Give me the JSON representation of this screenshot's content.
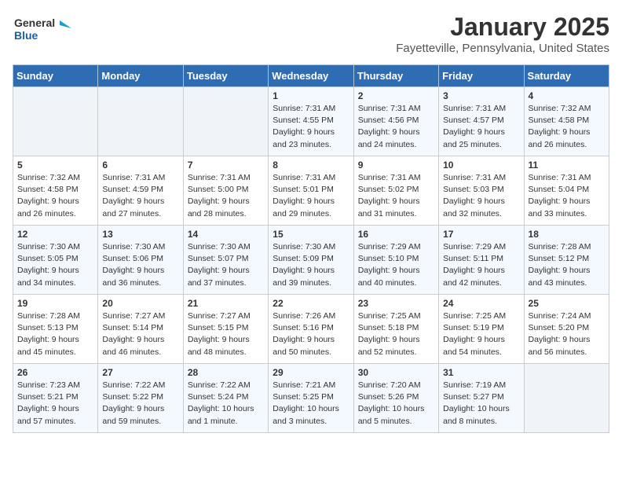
{
  "header": {
    "logo_line1": "General",
    "logo_line2": "Blue",
    "month": "January 2025",
    "location": "Fayetteville, Pennsylvania, United States"
  },
  "weekdays": [
    "Sunday",
    "Monday",
    "Tuesday",
    "Wednesday",
    "Thursday",
    "Friday",
    "Saturday"
  ],
  "weeks": [
    [
      {
        "day": "",
        "info": ""
      },
      {
        "day": "",
        "info": ""
      },
      {
        "day": "",
        "info": ""
      },
      {
        "day": "1",
        "info": "Sunrise: 7:31 AM\nSunset: 4:55 PM\nDaylight: 9 hours\nand 23 minutes."
      },
      {
        "day": "2",
        "info": "Sunrise: 7:31 AM\nSunset: 4:56 PM\nDaylight: 9 hours\nand 24 minutes."
      },
      {
        "day": "3",
        "info": "Sunrise: 7:31 AM\nSunset: 4:57 PM\nDaylight: 9 hours\nand 25 minutes."
      },
      {
        "day": "4",
        "info": "Sunrise: 7:32 AM\nSunset: 4:58 PM\nDaylight: 9 hours\nand 26 minutes."
      }
    ],
    [
      {
        "day": "5",
        "info": "Sunrise: 7:32 AM\nSunset: 4:58 PM\nDaylight: 9 hours\nand 26 minutes."
      },
      {
        "day": "6",
        "info": "Sunrise: 7:31 AM\nSunset: 4:59 PM\nDaylight: 9 hours\nand 27 minutes."
      },
      {
        "day": "7",
        "info": "Sunrise: 7:31 AM\nSunset: 5:00 PM\nDaylight: 9 hours\nand 28 minutes."
      },
      {
        "day": "8",
        "info": "Sunrise: 7:31 AM\nSunset: 5:01 PM\nDaylight: 9 hours\nand 29 minutes."
      },
      {
        "day": "9",
        "info": "Sunrise: 7:31 AM\nSunset: 5:02 PM\nDaylight: 9 hours\nand 31 minutes."
      },
      {
        "day": "10",
        "info": "Sunrise: 7:31 AM\nSunset: 5:03 PM\nDaylight: 9 hours\nand 32 minutes."
      },
      {
        "day": "11",
        "info": "Sunrise: 7:31 AM\nSunset: 5:04 PM\nDaylight: 9 hours\nand 33 minutes."
      }
    ],
    [
      {
        "day": "12",
        "info": "Sunrise: 7:30 AM\nSunset: 5:05 PM\nDaylight: 9 hours\nand 34 minutes."
      },
      {
        "day": "13",
        "info": "Sunrise: 7:30 AM\nSunset: 5:06 PM\nDaylight: 9 hours\nand 36 minutes."
      },
      {
        "day": "14",
        "info": "Sunrise: 7:30 AM\nSunset: 5:07 PM\nDaylight: 9 hours\nand 37 minutes."
      },
      {
        "day": "15",
        "info": "Sunrise: 7:30 AM\nSunset: 5:09 PM\nDaylight: 9 hours\nand 39 minutes."
      },
      {
        "day": "16",
        "info": "Sunrise: 7:29 AM\nSunset: 5:10 PM\nDaylight: 9 hours\nand 40 minutes."
      },
      {
        "day": "17",
        "info": "Sunrise: 7:29 AM\nSunset: 5:11 PM\nDaylight: 9 hours\nand 42 minutes."
      },
      {
        "day": "18",
        "info": "Sunrise: 7:28 AM\nSunset: 5:12 PM\nDaylight: 9 hours\nand 43 minutes."
      }
    ],
    [
      {
        "day": "19",
        "info": "Sunrise: 7:28 AM\nSunset: 5:13 PM\nDaylight: 9 hours\nand 45 minutes."
      },
      {
        "day": "20",
        "info": "Sunrise: 7:27 AM\nSunset: 5:14 PM\nDaylight: 9 hours\nand 46 minutes."
      },
      {
        "day": "21",
        "info": "Sunrise: 7:27 AM\nSunset: 5:15 PM\nDaylight: 9 hours\nand 48 minutes."
      },
      {
        "day": "22",
        "info": "Sunrise: 7:26 AM\nSunset: 5:16 PM\nDaylight: 9 hours\nand 50 minutes."
      },
      {
        "day": "23",
        "info": "Sunrise: 7:25 AM\nSunset: 5:18 PM\nDaylight: 9 hours\nand 52 minutes."
      },
      {
        "day": "24",
        "info": "Sunrise: 7:25 AM\nSunset: 5:19 PM\nDaylight: 9 hours\nand 54 minutes."
      },
      {
        "day": "25",
        "info": "Sunrise: 7:24 AM\nSunset: 5:20 PM\nDaylight: 9 hours\nand 56 minutes."
      }
    ],
    [
      {
        "day": "26",
        "info": "Sunrise: 7:23 AM\nSunset: 5:21 PM\nDaylight: 9 hours\nand 57 minutes."
      },
      {
        "day": "27",
        "info": "Sunrise: 7:22 AM\nSunset: 5:22 PM\nDaylight: 9 hours\nand 59 minutes."
      },
      {
        "day": "28",
        "info": "Sunrise: 7:22 AM\nSunset: 5:24 PM\nDaylight: 10 hours\nand 1 minute."
      },
      {
        "day": "29",
        "info": "Sunrise: 7:21 AM\nSunset: 5:25 PM\nDaylight: 10 hours\nand 3 minutes."
      },
      {
        "day": "30",
        "info": "Sunrise: 7:20 AM\nSunset: 5:26 PM\nDaylight: 10 hours\nand 5 minutes."
      },
      {
        "day": "31",
        "info": "Sunrise: 7:19 AM\nSunset: 5:27 PM\nDaylight: 10 hours\nand 8 minutes."
      },
      {
        "day": "",
        "info": ""
      }
    ]
  ]
}
